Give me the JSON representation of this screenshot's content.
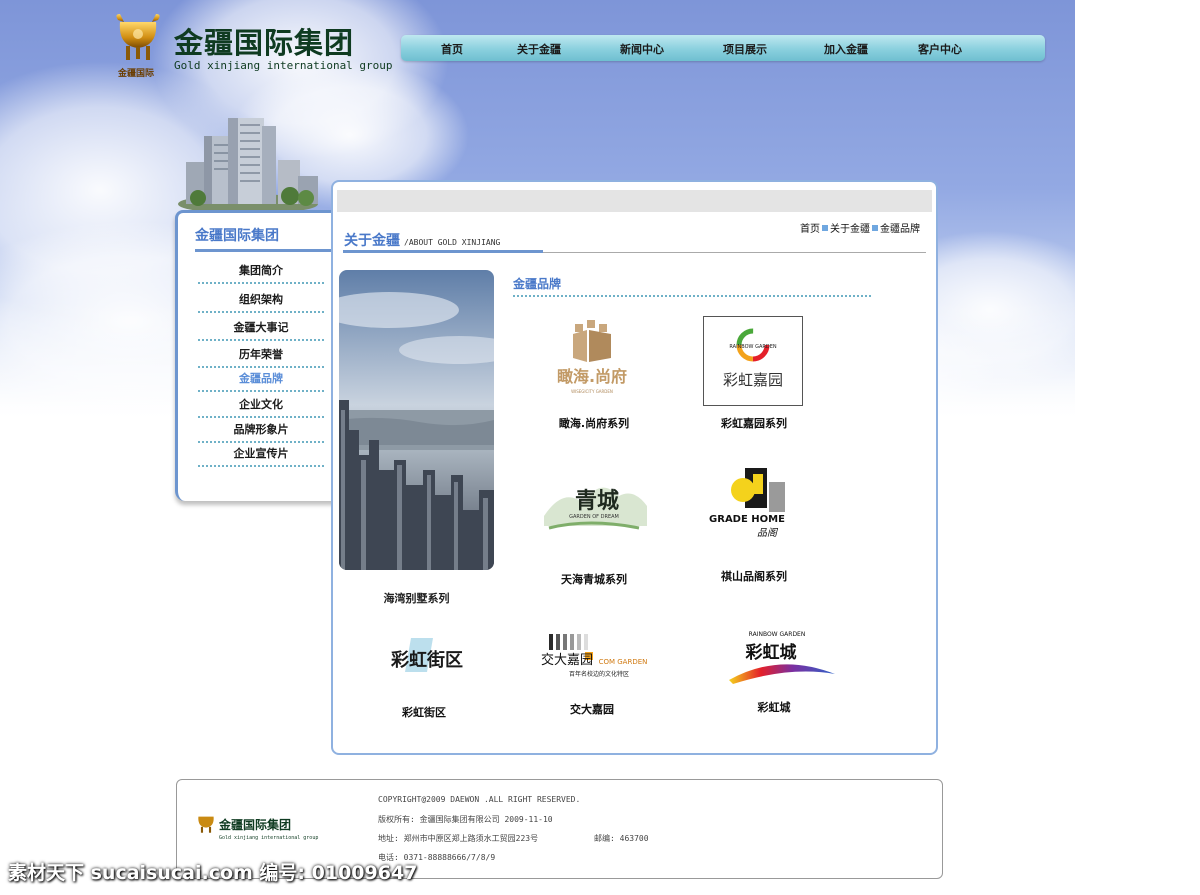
{
  "logo": {
    "name_cn": "金疆国际集团",
    "name_en": "Gold xinjiang international group",
    "emblem_label": "金疆国际"
  },
  "nav": {
    "items": [
      "首页",
      "关于金疆",
      "新闻中心",
      "项目展示",
      "加入金疆",
      "客户中心"
    ]
  },
  "sidebar": {
    "title": "金疆国际集团",
    "items": [
      "集团简介",
      "组织架构",
      "金疆大事记",
      "历年荣誉",
      "金疆品牌",
      "企业文化",
      "品牌形象片",
      "企业宣传片"
    ],
    "active_item": "金疆品牌"
  },
  "main": {
    "section_title_cn": "关于金疆",
    "section_title_en": "/ABOUT GOLD XINJIANG",
    "breadcrumb": [
      "首页",
      "关于金疆",
      "金疆品牌"
    ],
    "brand_heading": "金疆品牌",
    "photo_caption": "海湾别墅系列",
    "brands": [
      {
        "caption": "瞰海.尚府系列",
        "logo_text": "瞰海.尚府",
        "logo_sub": "WISEGICITY GARDEN"
      },
      {
        "caption": "彩虹嘉园系列",
        "logo_text": "彩虹嘉园",
        "logo_sub": "RAINBOW GARDEN"
      },
      {
        "caption": "天海青城系列",
        "logo_text": "青城",
        "logo_sub": "GARDEN OF DREAM"
      },
      {
        "caption": "祺山品阁系列",
        "logo_text": "GRADE HOME",
        "logo_sub": "品阁"
      },
      {
        "caption": "彩虹街区",
        "logo_text": "彩虹街区",
        "logo_sub": ""
      },
      {
        "caption": "交大嘉园",
        "logo_text": "交大嘉园",
        "logo_sub": "COM GARDEN",
        "logo_sub2": "百年名校边的文化特区"
      },
      {
        "caption": "彩虹城",
        "logo_text": "彩虹城",
        "logo_sub": "RAINBOW GARDEN"
      }
    ]
  },
  "footer": {
    "logo_cn": "金疆国际集团",
    "logo_en": "Gold xinjiang international group",
    "copyright": "COPYRIGHT@2009 DAEWON .ALL RIGHT RESERVED.",
    "rights": "版权所有: 金疆国际集团有限公司 2009-11-10",
    "address": "地址: 郑州市中原区郑上路须水工贸园223号",
    "postcode": "邮编: 463700",
    "phone": "电话: 0371-88888666/7/8/9"
  },
  "watermark": "素材天下 sucaisucai.com  编号: 01009647",
  "colors": {
    "accent_blue": "#4a79c9",
    "nav_teal": "#8ad0de",
    "logo_green": "#0f3b21",
    "border_blue": "#8fb1e0"
  }
}
